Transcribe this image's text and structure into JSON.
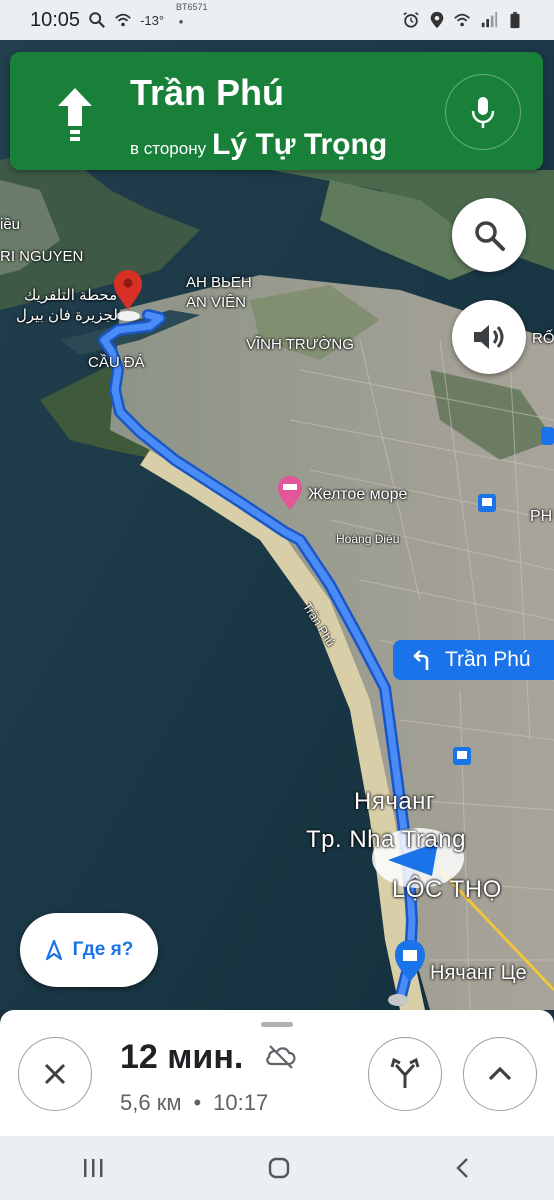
{
  "status_bar": {
    "time": "10:05",
    "temperature": "-13°",
    "carrier_text": "BT6571"
  },
  "navigation": {
    "street": "Trần Phú",
    "toward_prefix": "в сторону",
    "toward_street": "Lý Tự Trọng",
    "color": "#188038"
  },
  "map": {
    "labels": {
      "top_left_cut": "iều",
      "nguyen": "RI NGUYEN",
      "arabic_line1": "محطة التلفريك",
      "arabic_line2": "لجزيرة فان بيرل",
      "cau_da": "CẦU ĐÁ",
      "anh_vien_1": "AH BЬEH",
      "anh_vien_2": "AN VIÊN",
      "vinh_truong": "VĨNH TRƯỜNG",
      "right_cut_1": "RỐ",
      "yellow_sea": "Желтое море",
      "hoang_dieu": "Hoàng Diệu",
      "right_cut_2": "PH",
      "tran_phu_road": "Trần Phú",
      "nhatrang_ru": "Нячанг",
      "nhatrang_vi": "Tp. Nha Trang",
      "loc_tho": "LỘC THỌ",
      "nhatrang_center": "Нячанг Це"
    },
    "route_color": "#4285f4"
  },
  "turn_chip": {
    "label": "Trần Phú"
  },
  "where_am_i": {
    "label": "Где я?"
  },
  "bottom_sheet": {
    "eta": "12 мин.",
    "distance": "5,6 км",
    "separator": "•",
    "arrival": "10:17"
  }
}
